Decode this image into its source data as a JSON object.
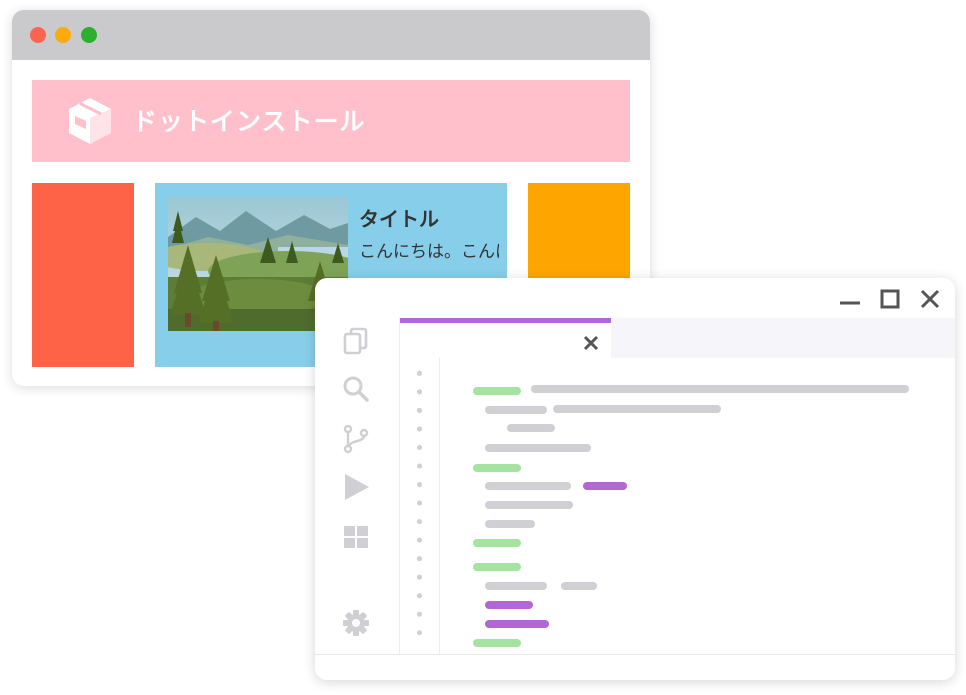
{
  "browser": {
    "site": {
      "logo_text": "ドットインストール"
    },
    "card": {
      "title": "タイトル",
      "text": "こんにちは。こんにちは。こんにちは。"
    },
    "colors": {
      "header": "#ffc0cb",
      "left_column": "#ff6347",
      "card": "#87ceeb",
      "right_column": "#ffa500"
    }
  },
  "editor": {
    "window_controls": [
      "minimize-icon",
      "maximize-icon",
      "close-icon"
    ],
    "activity_icons": [
      "files-icon",
      "search-icon",
      "source-control-icon",
      "run-icon",
      "extensions-icon",
      "gear-icon"
    ],
    "tab_close_icon": "close-icon",
    "colors": {
      "tab_accent": "#b267d4",
      "keyword": "#a5e3a1",
      "string": "#b267d4",
      "text": "#cfcfd4"
    }
  }
}
